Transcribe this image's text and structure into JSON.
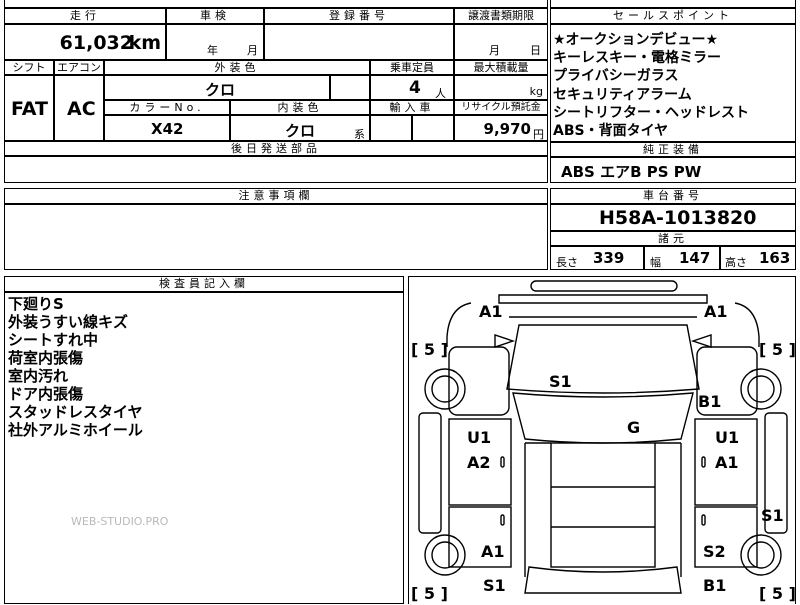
{
  "top": {
    "labels": {
      "mileage": "走行",
      "inspection": "車検",
      "registration": "登録番号",
      "transfer_deadline": "譲渡書類期限",
      "shift": "シフト",
      "aircon": "エアコン",
      "exterior_color": "外装色",
      "capacity": "乗車定員",
      "max_load": "最大積載量",
      "color_no": "カラーNo.",
      "interior_color": "内装色",
      "import": "輸入車",
      "recycle": "リサイクル預託金"
    },
    "mileage_value": "61,032",
    "mileage_unit": "km",
    "year_unit": "年",
    "month_unit": "月",
    "month_label": "月",
    "day_label": "日",
    "shift_value": "FAT",
    "aircon_value": "AC",
    "exterior_color_value": "クロ",
    "capacity_value": "4",
    "capacity_unit": "人",
    "load_unit": "kg",
    "color_no_value": "X42",
    "interior_color_value": "クロ",
    "interior_suffix": "系",
    "recycle_value": "9,970",
    "recycle_unit": "円",
    "later_parts_label": "後日発送部品"
  },
  "sales": {
    "header": "セールスポイント",
    "points": [
      "★オークションデビュー★",
      "キーレスキー・電格ミラー",
      "プライバシーガラス",
      "セキュリティアラーム",
      "シートリフター・ヘッドレスト",
      "ABS・背面タイヤ"
    ]
  },
  "equipment": {
    "header": "純正装備",
    "value": "ABS エアB PS PW"
  },
  "notes": {
    "header": "注意事項欄"
  },
  "chassis": {
    "header": "車台番号",
    "value": "H58A-1013820"
  },
  "specs": {
    "header": "諸元",
    "length_label": "長さ",
    "length_value": "339",
    "width_label": "幅",
    "width_value": "147",
    "height_label": "高さ",
    "height_value": "163"
  },
  "inspector": {
    "header": "検査員記入欄",
    "comments": [
      "下廻りS",
      "外装うすい線キズ",
      "シートすれ中",
      "荷室内張傷",
      "室内汚れ",
      "ドア内張傷",
      "スタッドレスタイヤ",
      "社外アルミホイール"
    ]
  },
  "watermark": "WEB-STUDIO.PRO",
  "diagram": {
    "marks": {
      "front_left": "A1",
      "front_right": "A1",
      "tire_fl": "[ 5 ]",
      "tire_fr": "[ 5 ]",
      "tire_rl": "[ 5 ]",
      "tire_rr": "[ 5 ]",
      "hood": "S1",
      "fender_r": "B1",
      "roof": "G",
      "door_fl": "U1",
      "door_fl2": "A2",
      "door_fr": "U1",
      "door_fr2": "A1",
      "rear_r": "S1",
      "rear_l": "A1",
      "rear_r2": "S2",
      "bottom_l": "S1",
      "bottom_r": "B1"
    }
  }
}
